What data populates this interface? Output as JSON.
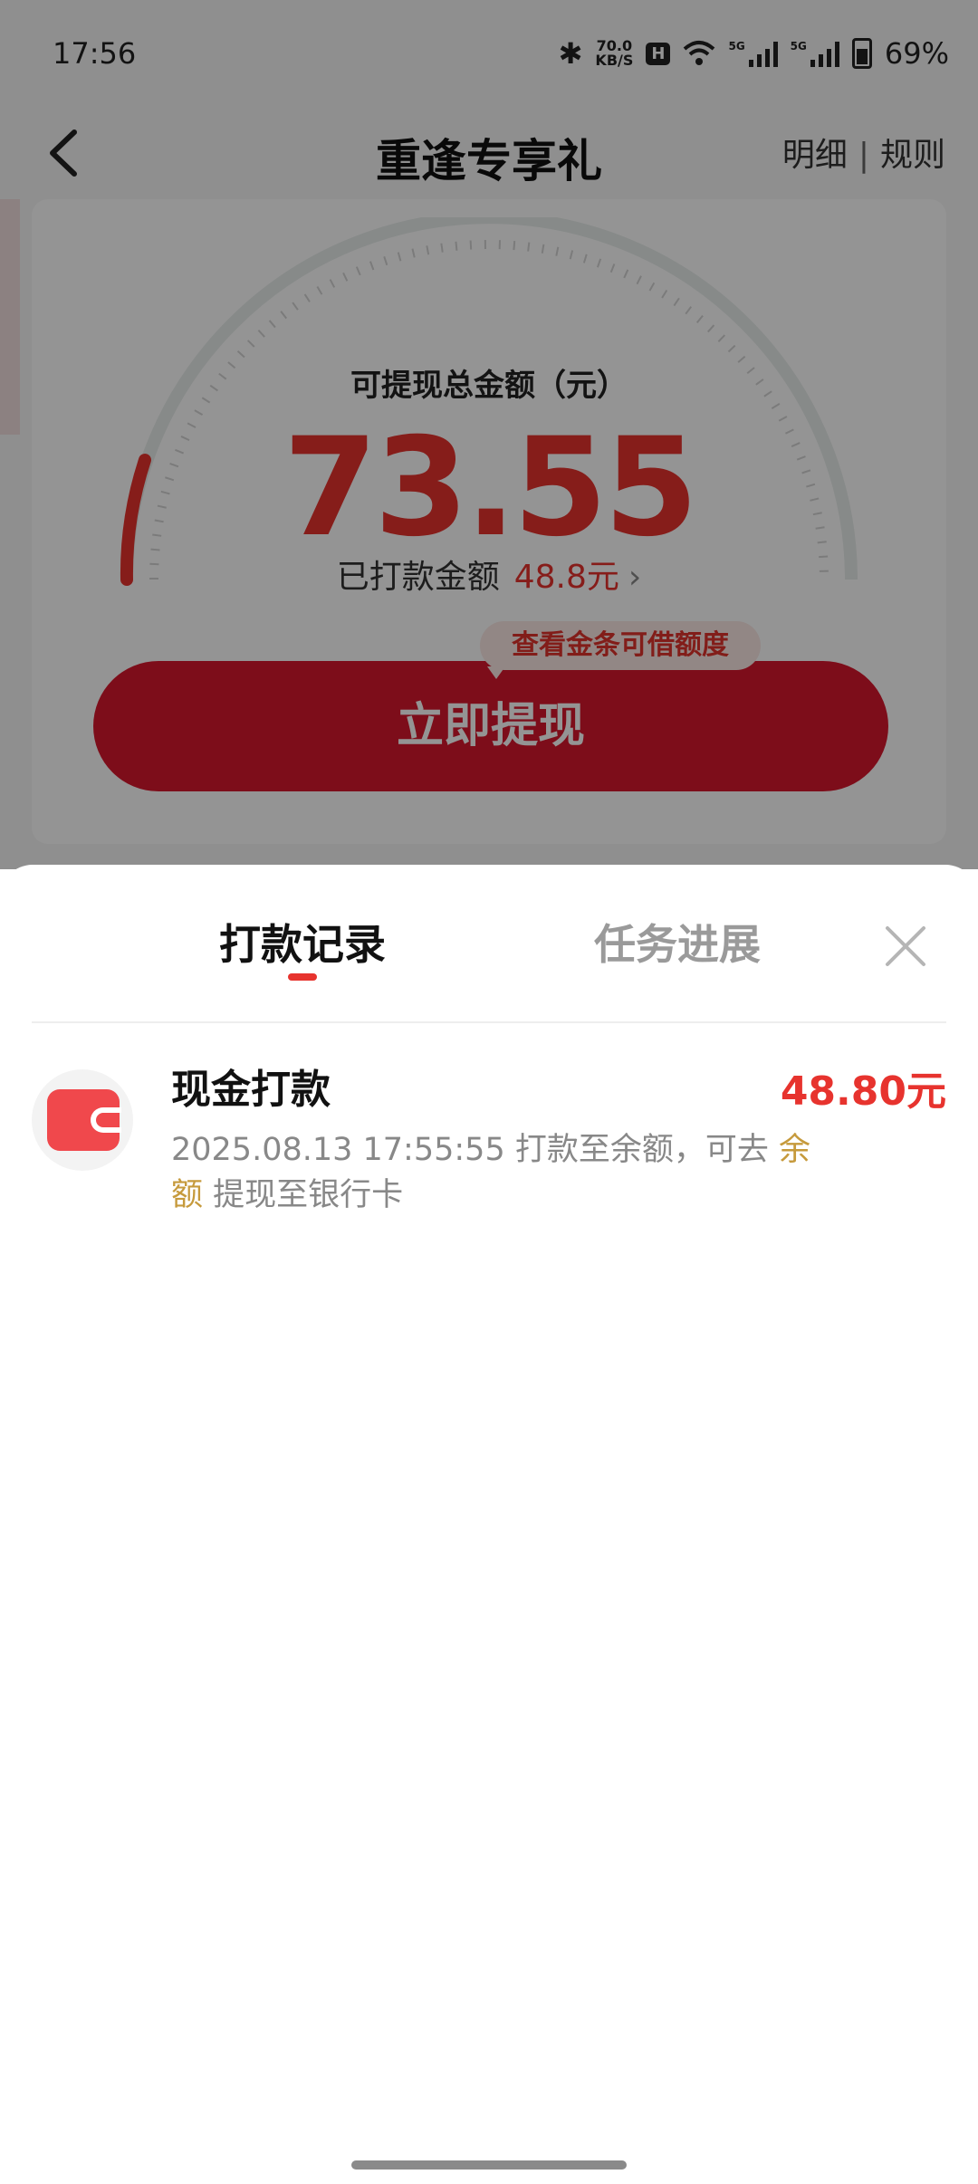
{
  "status_bar": {
    "time": "17:56",
    "net_speed_value": "70.0",
    "net_speed_unit": "KB/S",
    "hd_badge": "H",
    "signal_label_1": "5G",
    "signal_label_2": "5G",
    "battery": "69%"
  },
  "nav": {
    "title": "重逢专享礼",
    "detail_label": "明细",
    "separator": "|",
    "rules_label": "规则"
  },
  "card": {
    "total_label": "可提现总金额（元）",
    "total_amount": "73.55",
    "paid_label": "已打款金额",
    "paid_value": "48.8元",
    "paid_chevron": "›",
    "tooltip": "查看金条可借额度",
    "withdraw_button": "立即提现"
  },
  "sheet": {
    "tabs": [
      {
        "label": "打款记录",
        "active": true
      },
      {
        "label": "任务进展",
        "active": false
      }
    ],
    "records": [
      {
        "icon": "wallet-icon",
        "title": "现金打款",
        "amount": "48.80元",
        "desc_prefix": "2025.08.13 17:55:55 打款至余额，可去",
        "desc_link": "余额",
        "desc_suffix": "提现至银行卡"
      }
    ]
  },
  "colors": {
    "accent": "#e7332e",
    "button": "#d8182d",
    "link": "#c69a3c"
  }
}
